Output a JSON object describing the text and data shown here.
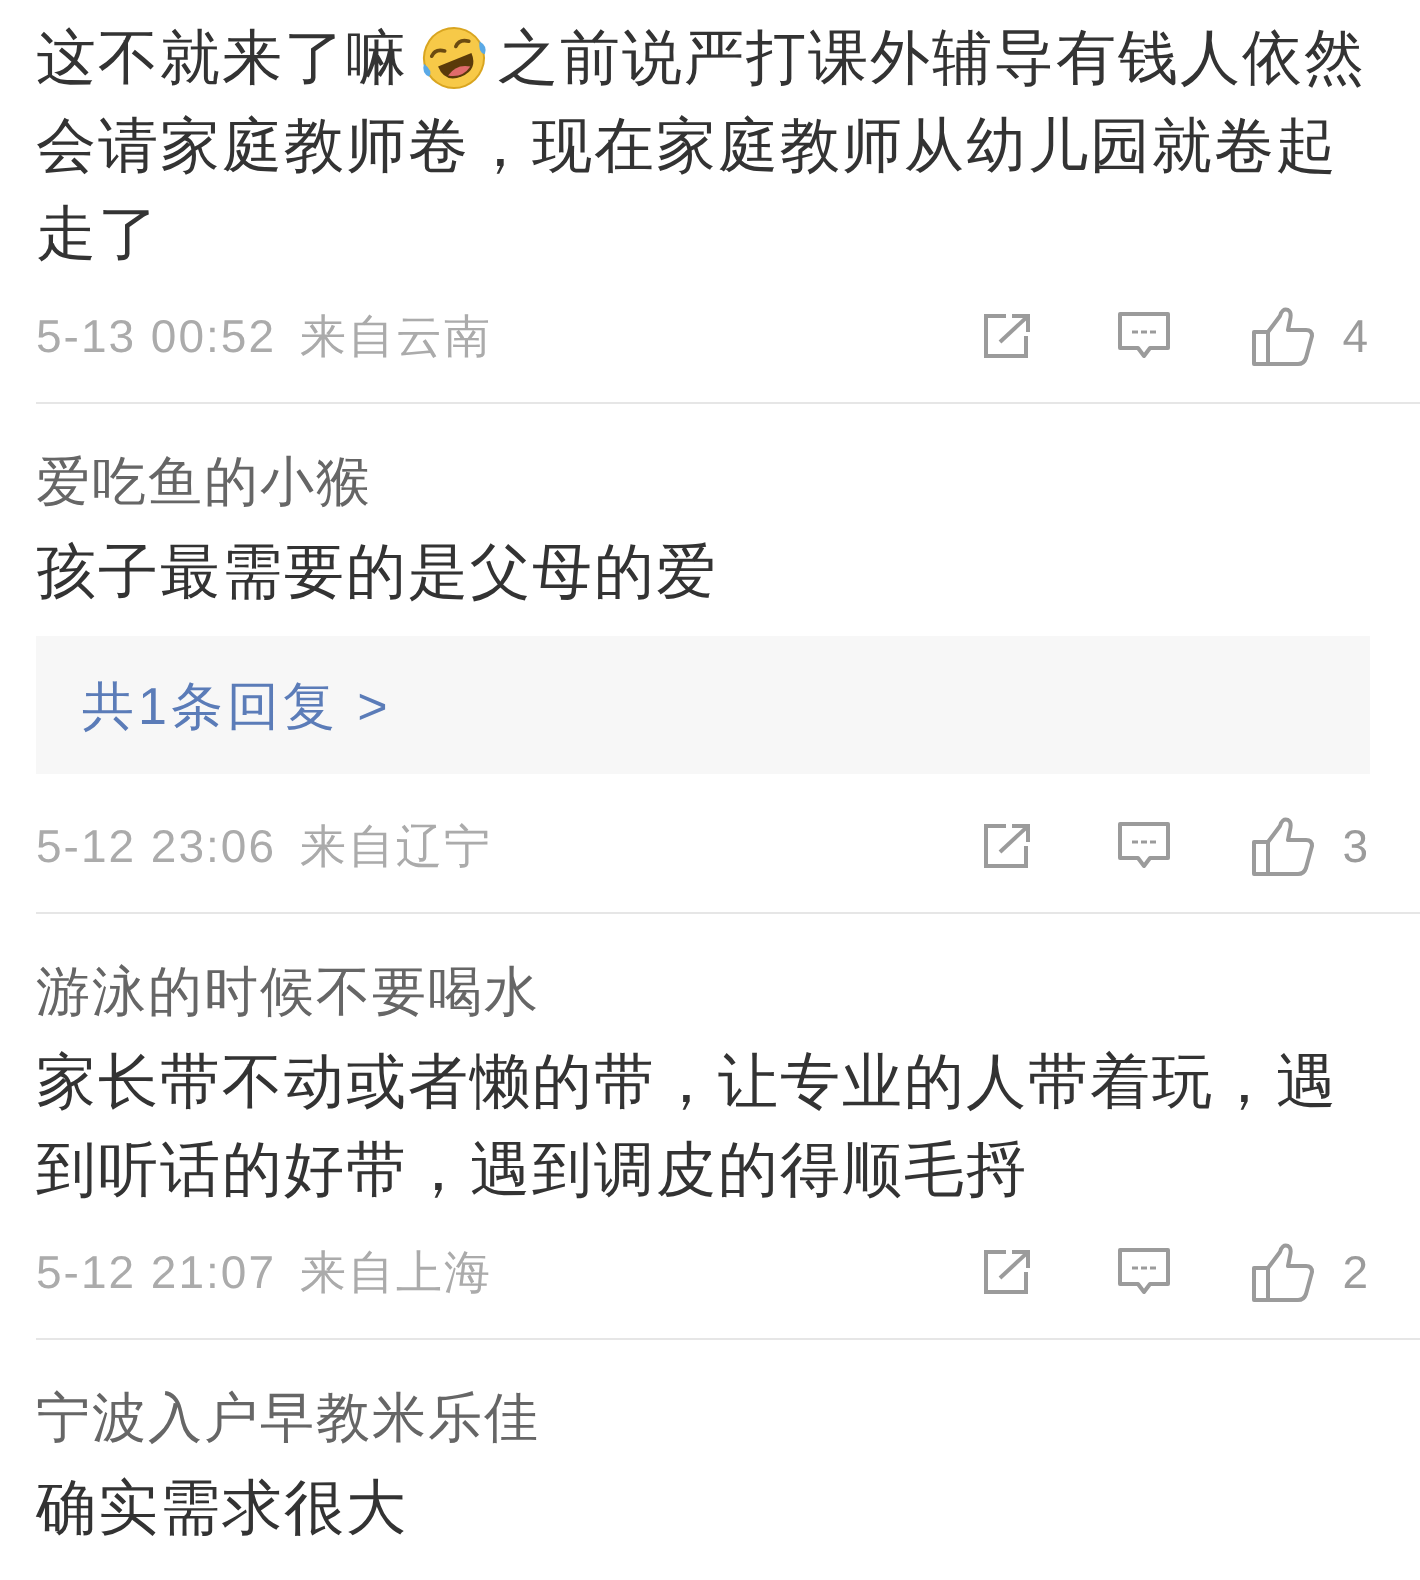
{
  "comments": [
    {
      "segments": [
        {
          "kind": "text",
          "text": "这不就来了嘛"
        },
        {
          "kind": "emoji"
        },
        {
          "kind": "text",
          "text": "之前说严打课外辅导有钱人依然会请家庭教师卷，现在家庭教师从幼儿园就卷起走了"
        }
      ],
      "time": "5-13 00:52",
      "location": "来自云南",
      "likes": "4"
    },
    {
      "username": "爱吃鱼的小猴",
      "segments": [
        {
          "kind": "text",
          "text": "孩子最需要的是父母的爱"
        }
      ],
      "replies": "共1条回复 >",
      "time": "5-12 23:06",
      "location": "来自辽宁",
      "likes": "3"
    },
    {
      "username": "游泳的时候不要喝水",
      "segments": [
        {
          "kind": "text",
          "text": "家长带不动或者懒的带，让专业的人带着玩，遇到听话的好带，遇到调皮的得顺毛捋"
        }
      ],
      "time": "5-12 21:07",
      "location": "来自上海",
      "likes": "2"
    },
    {
      "username": "宁波入户早教米乐佳",
      "segments": [
        {
          "kind": "text",
          "text": "确实需求很大"
        }
      ]
    }
  ]
}
